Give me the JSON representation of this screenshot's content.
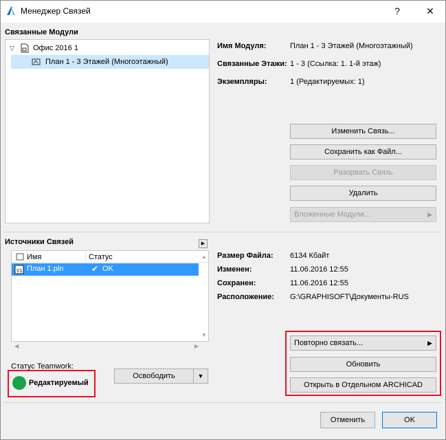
{
  "window": {
    "title": "Менеджер Связей",
    "help_label": "?",
    "close_label": "✕"
  },
  "modules": {
    "heading": "Связанные Модули",
    "tree": {
      "root_label": "Офис 2016 1",
      "child_label": "План 1 - 3 Этажей (Многоэтажный)"
    },
    "details": [
      {
        "label": "Имя Модуля:",
        "value": "План 1 - 3 Этажей (Многоэтажный)"
      },
      {
        "label": "Связанные Этажи:",
        "value": "1 - 3 (Ссылка: 1. 1-й этаж)"
      },
      {
        "label": "Экземпляры:",
        "value": "1 (Редактируемых: 1)"
      }
    ],
    "buttons": {
      "change_link": "Изменить Связь...",
      "save_as_file": "Сохранить как Файл...",
      "break_link": "Разорвать Связь",
      "delete": "Удалить",
      "nested_modules": "Вложенные Модули..."
    }
  },
  "sources": {
    "heading": "Источники Связей",
    "columns": [
      "Имя",
      "Статус"
    ],
    "rows": [
      {
        "name": "План 1.pln",
        "status": "OK"
      }
    ],
    "details": [
      {
        "label": "Размер Файла:",
        "value": "6134 Кбайт"
      },
      {
        "label": "Изменен:",
        "value": "11.06.2016 12:55"
      },
      {
        "label": "Сохранен:",
        "value": "11.06.2016 12:55"
      },
      {
        "label": "Расположение:",
        "value": "G:\\GRAPHISOFT\\Документы-RUS"
      }
    ],
    "buttons": {
      "relink": "Повторно связать...",
      "update": "Обновить",
      "open_separate": "Открыть в Отдельном ARCHICAD"
    }
  },
  "teamwork": {
    "label": "Статус Teamwork:",
    "status": "Редактируемый",
    "status_color": "#1aa34a",
    "release_button": "Освободить"
  },
  "footer": {
    "cancel": "Отменить",
    "ok": "OK"
  },
  "colors": {
    "highlight": "#e81123",
    "selection": "#cce8ff",
    "selection_strong": "#3399ff"
  }
}
